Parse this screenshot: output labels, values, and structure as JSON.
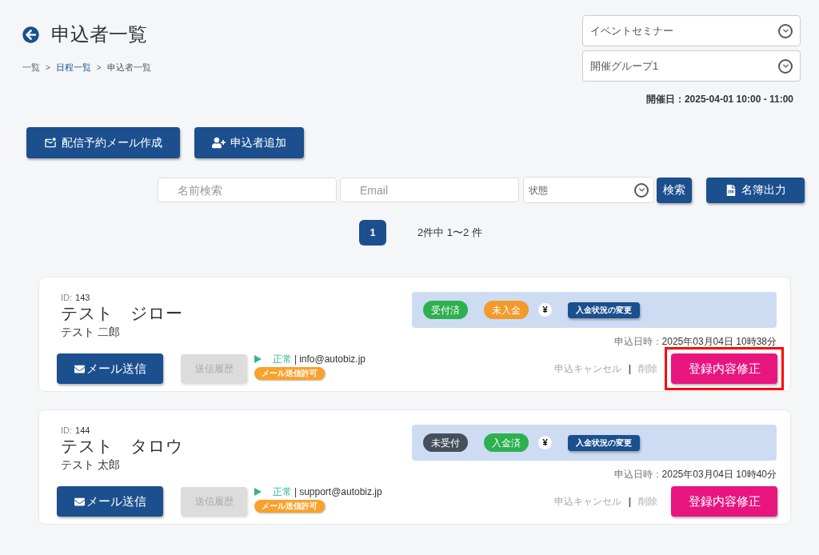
{
  "header": {
    "title": "申込者一覧",
    "breadcrumb_separator": ">",
    "breadcrumbs": [
      {
        "label": "一覧",
        "link": false
      },
      {
        "label": "日程一覧",
        "link": true
      },
      {
        "label": "申込者一覧",
        "link": false
      }
    ]
  },
  "selectors": [
    {
      "value": "イベントセミナー"
    },
    {
      "value": "開催グループ1"
    }
  ],
  "event_date": "開催日：2025-04-01 10:00 - 11:00",
  "actions": [
    {
      "label": "配信予約メール作成",
      "kind": "mail"
    },
    {
      "label": "申込者追加",
      "kind": "user"
    }
  ],
  "search": {
    "name_placeholder": "名前検索",
    "email_placeholder": "Email",
    "status_placeholder": "状態",
    "search_button": "検索",
    "export_button": "名簿出力"
  },
  "pagination": {
    "pages": [
      {
        "label": "1",
        "selected": true
      }
    ],
    "summary": "2件中 1〜2 件"
  },
  "applicants": [
    {
      "id_label": "ID:",
      "id": "143",
      "name_kana": "テスト　ジロー",
      "name": "テスト 二郎",
      "badges": [
        {
          "label": "受付済",
          "color": "#2eb04f"
        },
        {
          "label": "未入金",
          "color": "#f39a2b"
        }
      ],
      "yen": "¥",
      "payment_button": "入金状況の変更",
      "date_label": "申込日時：",
      "date": "2025年03月04日 10時38分",
      "mail_button": "メール送信",
      "history_button": "送信履歴",
      "mail_status": "正常",
      "mail_separator": "|",
      "email": "info@autobiz.jp",
      "mail_permission": "メール送信許可",
      "cancel_link": "申込キャンセル",
      "separator": "|",
      "delete_link": "削除",
      "edit_button": "登録内容修正",
      "highlighted": true
    },
    {
      "id_label": "ID:",
      "id": "144",
      "name_kana": "テスト　タロウ",
      "name": "テスト 太郎",
      "badges": [
        {
          "label": "未受付",
          "color": "#454f5b"
        },
        {
          "label": "入金済",
          "color": "#2eb04f"
        }
      ],
      "yen": "¥",
      "payment_button": "入金状況の変更",
      "date_label": "申込日時：",
      "date": "2025年03月04日 10時40分",
      "mail_button": "メール送信",
      "history_button": "送信履歴",
      "mail_status": "正常",
      "mail_separator": "|",
      "email": "support@autobiz.jp",
      "mail_permission": "メール送信許可",
      "cancel_link": "申込キャンセル",
      "separator": "|",
      "delete_link": "削除",
      "edit_button": "登録内容修正",
      "highlighted": false
    }
  ]
}
